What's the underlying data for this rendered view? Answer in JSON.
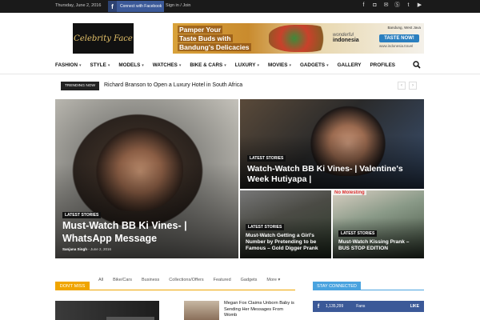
{
  "topbar": {
    "date": "Thursday, June 2, 2016",
    "connect_label": "Connect with Facebook",
    "signin_label": "Sign in / Join"
  },
  "social_icons": [
    "facebook-icon",
    "instagram-icon",
    "mail-icon",
    "skype-icon",
    "twitter-icon",
    "youtube-icon"
  ],
  "logo": {
    "text": "Celebrity Face"
  },
  "ad": {
    "line1": "Pamper Your",
    "line2": "Taste Buds with",
    "line3": "Bandung's Delicacies",
    "location": "Bandung, West Java",
    "brand_small": "wonderful",
    "brand": "indonesia",
    "cta": "TASTE NOW!",
    "url": "www.indonesia.travel"
  },
  "nav": {
    "items": [
      {
        "label": "FASHION",
        "dropdown": true
      },
      {
        "label": "STYLE",
        "dropdown": true
      },
      {
        "label": "MODELS",
        "dropdown": true
      },
      {
        "label": "WATCHES",
        "dropdown": true
      },
      {
        "label": "BIKE & CARS",
        "dropdown": true
      },
      {
        "label": "LUXURY",
        "dropdown": true
      },
      {
        "label": "MOVIES",
        "dropdown": true
      },
      {
        "label": "GADGETS",
        "dropdown": true
      },
      {
        "label": "GALLERY",
        "dropdown": false
      },
      {
        "label": "PROFILES",
        "dropdown": false
      }
    ]
  },
  "trending": {
    "badge": "TRENDING NOW",
    "headline": "Richard Branson to Open a Luxury Hotel in South Africa"
  },
  "featured": {
    "main": {
      "category": "LATEST STORIES",
      "title": "Must-Watch BB Ki Vines- | WhatsApp Message",
      "author": "Sanjana Singh",
      "date": "June 2, 2016"
    },
    "top_right": {
      "category": "LATEST STORIES",
      "title": "Watch-Watch BB Ki Vines- | Valentine's Week Hutiyapa |"
    },
    "bottom_left": {
      "category": "LATEST STORIES",
      "title": "Must-Watch Getting a Girl's Number by Pretending to be Famous – Gold Digger Prank"
    },
    "bottom_right": {
      "category": "LATEST STORIES",
      "title": "Must-Watch Kissing Prank – BUS STOP EDITION",
      "sign_text": "No Molesting"
    }
  },
  "dont_miss": {
    "badge": "DON'T MISS",
    "tabs": [
      "All",
      "Bike/Cars",
      "Business",
      "Collections/Offers",
      "Featured",
      "Gadgets",
      "More"
    ],
    "news_item": "Megan Fox Claims Unborn Baby is Sending Her Messages From Womb"
  },
  "stay_connected": {
    "badge": "STAY CONNECTED",
    "facebook": {
      "count": "1,135,299",
      "label": "Fans",
      "action": "LIKE"
    }
  },
  "colors": {
    "dont_miss": "#f0a500",
    "stay_connected": "#4aa3df",
    "facebook": "#3b5998"
  }
}
